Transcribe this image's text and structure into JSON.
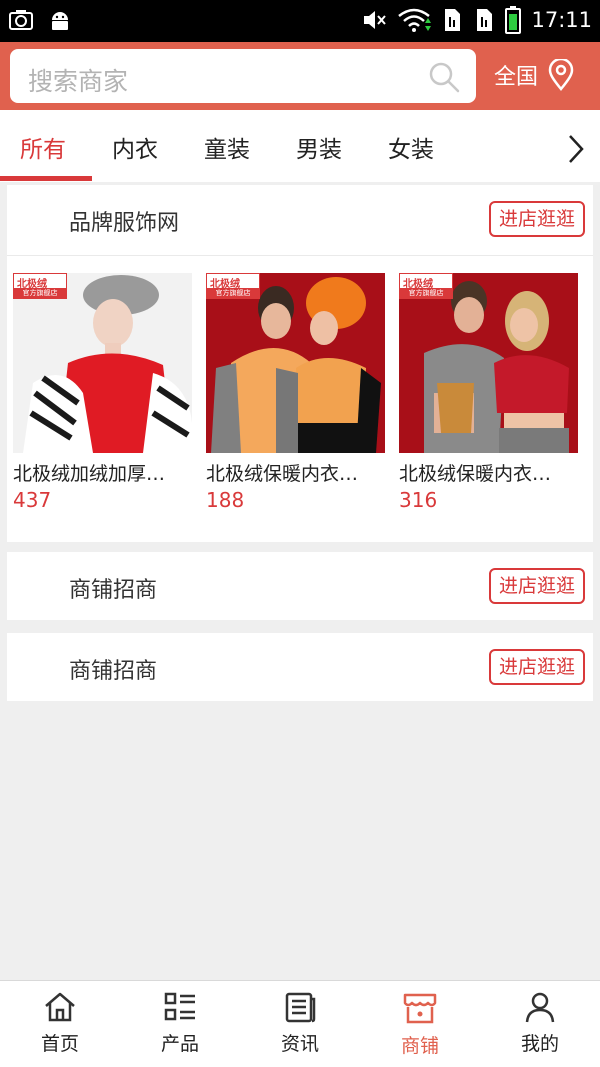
{
  "status_bar": {
    "time": "17:11",
    "left_icons": [
      "screenshot-icon",
      "android-icon"
    ],
    "right_icons": [
      "mute-icon",
      "wifi-icon",
      "sim1-icon",
      "sim2-icon",
      "battery-icon"
    ]
  },
  "header": {
    "search_placeholder": "搜索商家",
    "region_label": "全国",
    "accent_color": "#e0614e"
  },
  "tabs": {
    "items": [
      {
        "label": "所有",
        "active": true
      },
      {
        "label": "内衣",
        "active": false
      },
      {
        "label": "童装",
        "active": false
      },
      {
        "label": "男装",
        "active": false
      },
      {
        "label": "女装",
        "active": false
      }
    ]
  },
  "shops": [
    {
      "name": "品牌服饰网",
      "visit_label": "进店逛逛",
      "products": [
        {
          "name": "北极绒加绒加厚…",
          "price": "437",
          "brand_tag": "北极绒",
          "brand_sub": "官方旗舰店"
        },
        {
          "name": "北极绒保暖内衣…",
          "price": "188",
          "brand_tag": "北极绒",
          "brand_sub": "官方旗舰店"
        },
        {
          "name": "北极绒保暖内衣…",
          "price": "316",
          "brand_tag": "北极绒",
          "brand_sub": "官方旗舰店"
        }
      ]
    },
    {
      "name": "商铺招商",
      "visit_label": "进店逛逛"
    },
    {
      "name": "商铺招商",
      "visit_label": "进店逛逛"
    }
  ],
  "bottom_nav": {
    "items": [
      {
        "label": "首页",
        "icon": "home-icon",
        "active": false
      },
      {
        "label": "产品",
        "icon": "product-list-icon",
        "active": false
      },
      {
        "label": "资讯",
        "icon": "news-icon",
        "active": false
      },
      {
        "label": "商铺",
        "icon": "shop-icon",
        "active": true
      },
      {
        "label": "我的",
        "icon": "user-icon",
        "active": false
      }
    ]
  },
  "colors": {
    "accent_red": "#d9393a",
    "header_bg": "#e0614e",
    "page_bg": "#efefef"
  }
}
